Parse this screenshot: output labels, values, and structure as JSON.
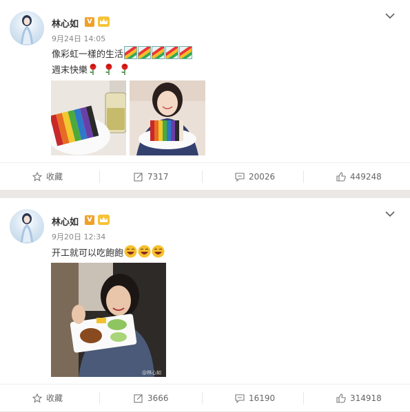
{
  "posts": [
    {
      "author": "林心如",
      "verified_badge": "V",
      "date": "9月24日 14:05",
      "text_line1": "像彩虹一樣的生活",
      "text_line2": "週末快樂",
      "emoji_line1": [
        "rainbow-icon",
        "rainbow-icon",
        "rainbow-icon",
        "rainbow-icon",
        "rainbow-icon"
      ],
      "emoji_line2": [
        "rose-icon",
        "rose-icon",
        "rose-icon"
      ],
      "actions": {
        "favorite": "收藏",
        "repost": "7317",
        "comment": "20026",
        "like": "449248"
      }
    },
    {
      "author": "林心如",
      "verified_badge": "V",
      "date": "9月20日 12:34",
      "text_line1": "开工就可以吃飽飽",
      "emoji_line1": [
        "laugh-icon",
        "laugh-icon",
        "laugh-icon"
      ],
      "photo_watermark": "@林心如",
      "actions": {
        "favorite": "收藏",
        "repost": "3666",
        "comment": "16190",
        "like": "314918"
      }
    }
  ],
  "colors": {
    "accent": "#f0a028",
    "text": "#333333",
    "muted": "#888888"
  }
}
